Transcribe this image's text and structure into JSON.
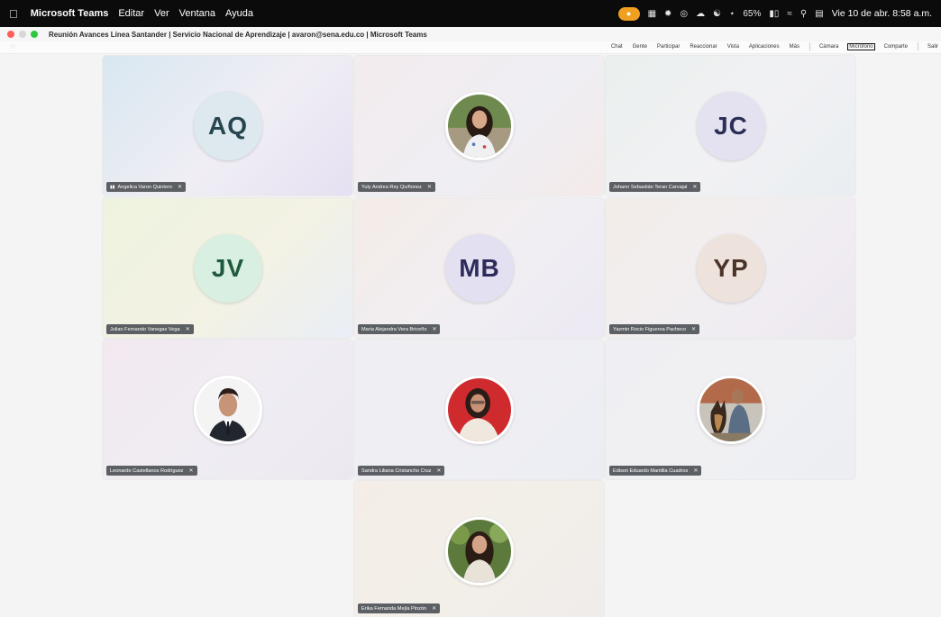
{
  "menubar": {
    "apple_icon": "apple-icon",
    "items": [
      "Microsoft Teams",
      "Editar",
      "Ver",
      "Ventana",
      "Ayuda"
    ],
    "battery": "65%",
    "clock": "Vie 10 de abr.  8:58 a.m."
  },
  "window": {
    "title": "Reunión Avances Línea Santander | Servicio Nacional de Aprendizaje | avaron@sena.edu.co | Microsoft Teams"
  },
  "toolbar": {
    "items": [
      "Chat",
      "Gente",
      "Participar",
      "Reaccionar",
      "Vista",
      "Aplicaciones",
      "Más",
      "Cámara",
      "Micrófono",
      "Comparte",
      "Salir"
    ],
    "active": "Micrófono"
  },
  "participants": [
    {
      "name": "Angelica Varon Quintero",
      "initials": "AQ",
      "speaking": true,
      "avatar_bg": "#dde9ef",
      "initials_color": "#27454f",
      "tile_bg": "linear-gradient(135deg,#d8e7f1,#f0eef4 55%,#e5e0f2)"
    },
    {
      "name": "Yuly Andrea Rey Quiñonez",
      "initials": "",
      "photo": "woman-dark-hair",
      "tile_bg": "linear-gradient(135deg,#f3ecee,#efeef3 60%,#f4eae9)"
    },
    {
      "name": "Johann Sebastián Teran Carvajal",
      "initials": "JC",
      "avatar_bg": "#e4e2f1",
      "initials_color": "#2c2f55",
      "tile_bg": "linear-gradient(135deg,#eaf0ee,#f1f1f3 55%,#e9eef2)"
    },
    {
      "name": "Julian Fernando Vanegas Vega",
      "initials": "JV",
      "avatar_bg": "#d9efe1",
      "initials_color": "#1f5a3c",
      "tile_bg": "linear-gradient(135deg,#eef3df,#f3f2e4 55%,#eaeef6)"
    },
    {
      "name": "Maria Alejandra Vera Briceño",
      "initials": "MB",
      "avatar_bg": "#e2e0f1",
      "initials_color": "#2d2b5a",
      "tile_bg": "linear-gradient(135deg,#f4ece6,#f1eef3 55%,#ece9f3)"
    },
    {
      "name": "Yazmin Rocio Figueroa Pacheco",
      "initials": "YP",
      "avatar_bg": "#eee3dc",
      "initials_color": "#4a3328",
      "tile_bg": "linear-gradient(135deg,#f3ede8,#f1eef2 55%,#ede8f0)"
    },
    {
      "name": "Leonardo Castellanos Rodriguez",
      "initials": "",
      "photo": "man-suit",
      "tile_bg": "linear-gradient(135deg,#f2e9ef,#efedf3 55%,#ece8f1)"
    },
    {
      "name": "Sandra Liliana Cristancho Cruz",
      "initials": "",
      "photo": "woman-red-bg",
      "tile_bg": "linear-gradient(135deg,#eeeef3,#efeff3 55%,#ebedf3)"
    },
    {
      "name": "Edison Eduardo Mantilla Cuadros",
      "initials": "",
      "photo": "man-with-dog",
      "tile_bg": "linear-gradient(135deg,#efeff3,#f0f0f3 55%,#eceef2)"
    },
    {
      "name": "Erika Fernanda Mejía Pinzón",
      "initials": "",
      "photo": "woman-outdoors",
      "tile_bg": "linear-gradient(135deg,#f5ede7,#f2efe9 55%,#f0ecea)"
    }
  ],
  "icons": {
    "mic_muted": "mic-off-icon",
    "signal": "audio-bars-icon"
  }
}
